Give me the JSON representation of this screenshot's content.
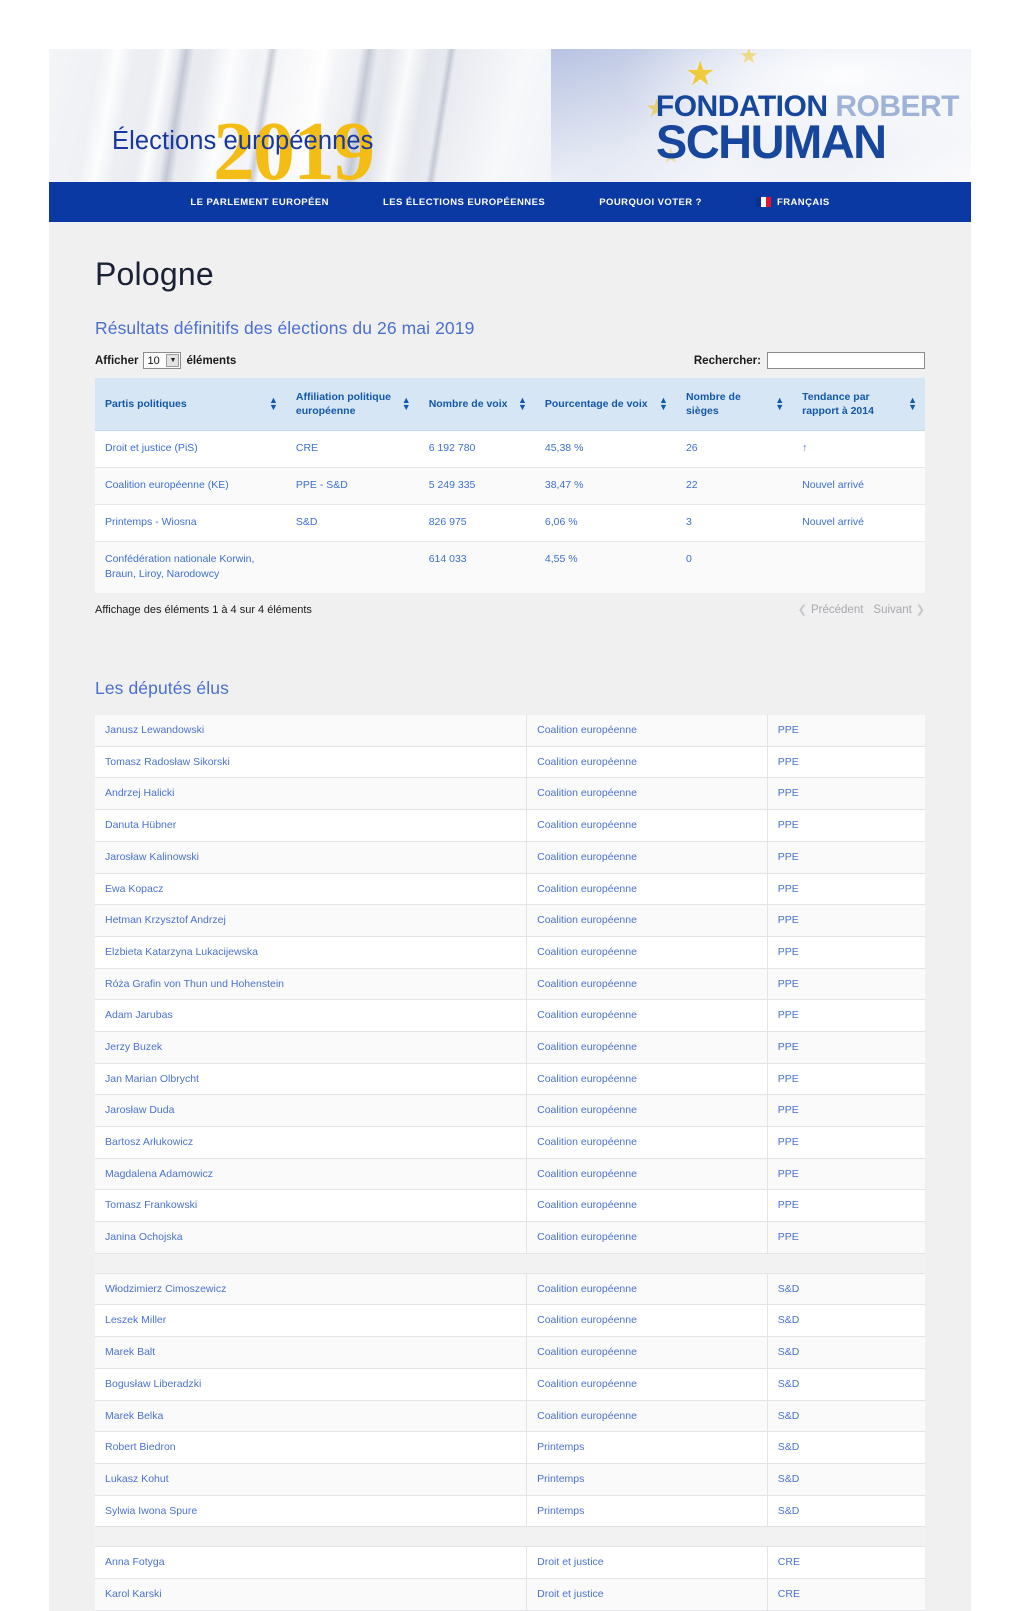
{
  "banner": {
    "title": "Élections européennes",
    "year": "2019",
    "logo_line1_a": "FONDATION",
    "logo_line1_b": "ROBERT",
    "logo_line2": "SCHUMAN"
  },
  "nav": {
    "items": [
      {
        "label": "LE PARLEMENT EUROPÉEN",
        "icon": ""
      },
      {
        "label": "LES ÉLECTIONS EUROPÉENNES",
        "icon": ""
      },
      {
        "label": "POURQUOI VOTER ?",
        "icon": ""
      },
      {
        "label": "FRANÇAIS",
        "icon": "french-flag-icon"
      }
    ]
  },
  "main": {
    "page_title": "Pologne",
    "results_subtitle": "Résultats définitifs des élections du 26 mai 2019",
    "deputies_title": "Les députés élus"
  },
  "datatable": {
    "length_prefix": "Afficher",
    "length_value": "10",
    "length_suffix": "éléments",
    "caret_icon": "chevron-down-icon",
    "search_label": "Rechercher:",
    "search_value": "",
    "search_placeholder": "",
    "info": "Affichage des éléments 1 à 4 sur 4 éléments",
    "prev_label": "Précédent",
    "next_label": "Suivant",
    "prev_icon": "chevron-left-icon",
    "next_icon": "chevron-right-icon",
    "sort_icon": "sort-updown-icon"
  },
  "results_table": {
    "columns": [
      "Partis politiques",
      "Affiliation politique européenne",
      "Nombre de voix",
      "Pourcentage de voix",
      "Nombre de sièges",
      "Tendance par rapport à 2014"
    ],
    "rows": [
      {
        "parti": "Droit et justice (PiS)",
        "affiliation": "CRE",
        "voix": "6 192 780",
        "pourcentage": "45,38 %",
        "sieges": "26",
        "tendance": "↑"
      },
      {
        "parti": "Coalition européenne (KE)",
        "affiliation": "PPE - S&D",
        "voix": "5 249 335",
        "pourcentage": "38,47 %",
        "sieges": "22",
        "tendance": "Nouvel arrivé"
      },
      {
        "parti": "Printemps - Wiosna",
        "affiliation": "S&D",
        "voix": "826 975",
        "pourcentage": "6,06 %",
        "sieges": "3",
        "tendance": "Nouvel arrivé"
      },
      {
        "parti": "Confédération nationale Korwin, Braun, Liroy, Narodowcy",
        "affiliation": "",
        "voix": "614 033",
        "pourcentage": "4,55 %",
        "sieges": "0",
        "tendance": ""
      }
    ]
  },
  "deputies_table": {
    "rows": [
      {
        "name": "Janusz Lewandowski",
        "party": "Coalition européenne",
        "group": "PPE"
      },
      {
        "name": "Tomasz Radosław Sikorski",
        "party": "Coalition européenne",
        "group": "PPE"
      },
      {
        "name": "Andrzej Halicki",
        "party": "Coalition européenne",
        "group": "PPE"
      },
      {
        "name": "Danuta Hübner",
        "party": "Coalition européenne",
        "group": "PPE"
      },
      {
        "name": "Jarosław Kalinowski",
        "party": "Coalition européenne",
        "group": "PPE"
      },
      {
        "name": "Ewa Kopacz",
        "party": "Coalition européenne",
        "group": "PPE"
      },
      {
        "name": "Hetman Krzysztof Andrzej",
        "party": "Coalition européenne",
        "group": "PPE"
      },
      {
        "name": "Elzbieta Katarzyna Lukacijewska",
        "party": "Coalition européenne",
        "group": "PPE"
      },
      {
        "name": "Róża Grafin von Thun und Hohenstein",
        "party": "Coalition européenne",
        "group": "PPE"
      },
      {
        "name": "Adam Jarubas",
        "party": "Coalition européenne",
        "group": "PPE"
      },
      {
        "name": "Jerzy Buzek",
        "party": "Coalition européenne",
        "group": "PPE"
      },
      {
        "name": "Jan Marian Olbrycht",
        "party": "Coalition européenne",
        "group": "PPE"
      },
      {
        "name": "Jarosław Duda",
        "party": "Coalition européenne",
        "group": "PPE"
      },
      {
        "name": "Bartosz Arłukowicz",
        "party": "Coalition européenne",
        "group": "PPE"
      },
      {
        "name": "Magdalena Adamowicz",
        "party": "Coalition européenne",
        "group": "PPE"
      },
      {
        "name": "Tomasz Frankowski",
        "party": "Coalition européenne",
        "group": "PPE"
      },
      {
        "name": "Janina Ochojska",
        "party": "Coalition européenne",
        "group": "PPE"
      },
      {
        "spacer": true
      },
      {
        "name": "Włodzimierz Cimoszewicz",
        "party": "Coalition européenne",
        "group": "S&D"
      },
      {
        "name": "Leszek Miller",
        "party": "Coalition européenne",
        "group": "S&D"
      },
      {
        "name": "Marek Balt",
        "party": "Coalition européenne",
        "group": "S&D"
      },
      {
        "name": "Bogusław Liberadzki",
        "party": "Coalition européenne",
        "group": "S&D"
      },
      {
        "name": "Marek Belka",
        "party": "Coalition européenne",
        "group": "S&D"
      },
      {
        "name": "Robert Biedron",
        "party": "Printemps",
        "group": "S&D"
      },
      {
        "name": "Lukasz Kohut",
        "party": "Printemps",
        "group": "S&D"
      },
      {
        "name": "Sylwia Iwona Spure",
        "party": "Printemps",
        "group": "S&D"
      },
      {
        "spacer": true
      },
      {
        "name": "Anna Fotyga",
        "party": "Droit et justice",
        "group": "CRE"
      },
      {
        "name": "Karol Karski",
        "party": "Droit et justice",
        "group": "CRE"
      }
    ]
  },
  "colors": {
    "nav_blue": "#0b39a3",
    "brand_blue": "#17479d",
    "accent_yellow": "#f3bd16",
    "link_blue": "#4a6fd0",
    "table_header_bg": "#d6e6f5",
    "table_header_text": "#1358a8",
    "page_bg": "#f0f0f0"
  }
}
